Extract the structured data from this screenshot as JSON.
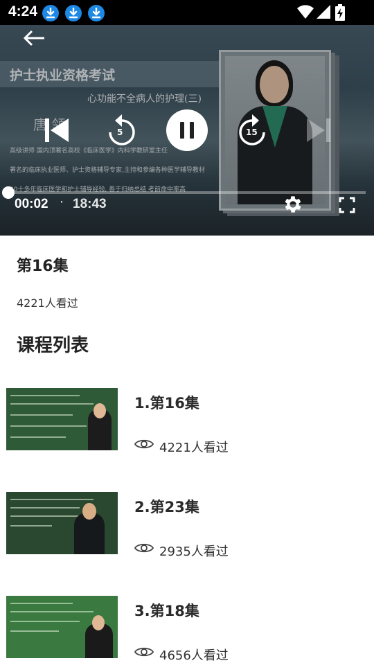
{
  "status_bar": {
    "time": "4:24",
    "download_icon_count": 3,
    "accent": "#1e88e5"
  },
  "video": {
    "slide_title": "护士执业资格考试",
    "slide_subtitle": "心功能不全病人的护理(三)",
    "slide_partial": "唐 领",
    "slide_bullets": [
      "高级讲师 国内顶著名高校《临床医学》内科学教研室主任",
      "著名的临床执业医师、护士资格辅导专家,主持和参编各种医学辅导教材",
      "30十多年临床医学和护士辅导经验, 善于归纳总结 考前命中率高"
    ],
    "rewind_seconds": "5",
    "forward_seconds": "15",
    "current_time": "00:02",
    "separator": "·",
    "total_time": "18:43",
    "progress": 0.002
  },
  "episode": {
    "title": "第16集",
    "views": "4221人看过"
  },
  "course_list": {
    "title": "课程列表",
    "items": [
      {
        "title": "1.第16集",
        "views": "4221人看过",
        "board_color": "#2f5a37"
      },
      {
        "title": "2.第23集",
        "views": "2935人看过",
        "board_color": "#2a4730"
      },
      {
        "title": "3.第18集",
        "views": "4656人看过",
        "board_color": "#3a7a40"
      }
    ]
  }
}
